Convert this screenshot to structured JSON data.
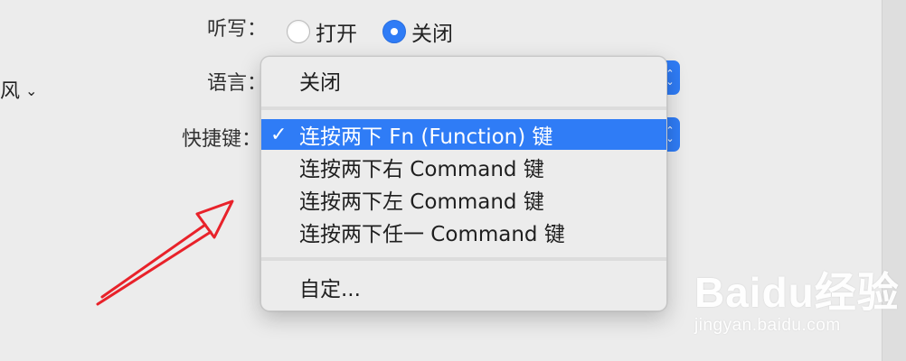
{
  "left": {
    "label": "风"
  },
  "settings": {
    "dictation": {
      "label": "听写：",
      "on_label": "打开",
      "off_label": "关闭",
      "selected": "off"
    },
    "language": {
      "label": "语言："
    },
    "shortcut": {
      "label": "快捷键："
    }
  },
  "menu": {
    "items": [
      {
        "label": "关闭",
        "selected": false
      },
      {
        "label": "连按两下 Fn (Function) 键",
        "selected": true,
        "check": "✓"
      },
      {
        "label": "连按两下右 Command 键",
        "selected": false
      },
      {
        "label": "连按两下左 Command 键",
        "selected": false
      },
      {
        "label": "连按两下任一 Command 键",
        "selected": false
      },
      {
        "label": "自定...",
        "selected": false
      }
    ]
  },
  "watermark": {
    "main": "Baidu经验",
    "sub": "jingyan.baidu.com"
  },
  "colors": {
    "accent": "#2f7cf6",
    "arrow": "#e8222a",
    "menu_bg": "#ececec"
  }
}
